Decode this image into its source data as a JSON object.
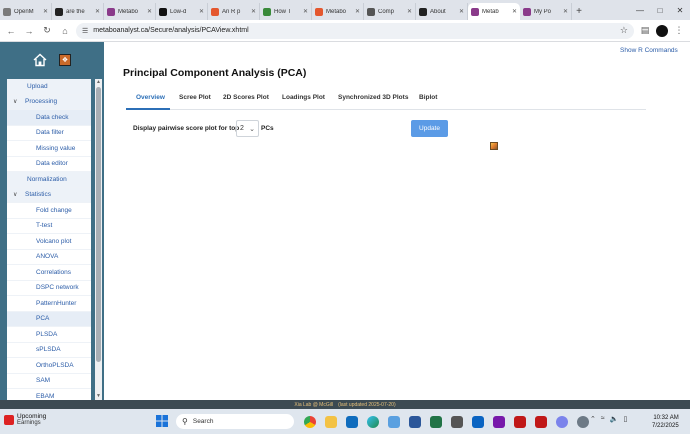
{
  "browser": {
    "tabs": [
      {
        "title": "OpenM",
        "color": "#7a7a7a"
      },
      {
        "title": "are the",
        "color": "#222222"
      },
      {
        "title": "Metabo",
        "color": "#8a3a8a"
      },
      {
        "title": "Low-d",
        "color": "#111111"
      },
      {
        "title": "An R p",
        "color": "#e4572e"
      },
      {
        "title": "How T",
        "color": "#3a8a3a"
      },
      {
        "title": "Metabo",
        "color": "#e4572e"
      },
      {
        "title": "Comp",
        "color": "#555555"
      },
      {
        "title": "About",
        "color": "#222222"
      },
      {
        "title": "Metab",
        "color": "#8a3a8a",
        "active": true
      },
      {
        "title": "My Po",
        "color": "#8a3a8a"
      }
    ],
    "url": "metaboanalyst.ca/Secure/analysis/PCAView.xhtml"
  },
  "sidebar": {
    "items": [
      {
        "label": "Upload",
        "level": 1
      },
      {
        "label": "Processing",
        "level": 1,
        "expanded": true
      },
      {
        "label": "Data check",
        "level": 2,
        "selected": true
      },
      {
        "label": "Data filter",
        "level": 2
      },
      {
        "label": "Missing value",
        "level": 2
      },
      {
        "label": "Data editor",
        "level": 2
      },
      {
        "label": "Normalization",
        "level": 1
      },
      {
        "label": "Statistics",
        "level": 1,
        "expanded": true
      },
      {
        "label": "Fold change",
        "level": 2
      },
      {
        "label": "T-test",
        "level": 2
      },
      {
        "label": "Volcano plot",
        "level": 2
      },
      {
        "label": "ANOVA",
        "level": 2
      },
      {
        "label": "Correlations",
        "level": 2
      },
      {
        "label": "DSPC network",
        "level": 2
      },
      {
        "label": "PatternHunter",
        "level": 2
      },
      {
        "label": "PCA",
        "level": 2,
        "selected": true
      },
      {
        "label": "PLSDA",
        "level": 2
      },
      {
        "label": "sPLSDA",
        "level": 2
      },
      {
        "label": "OrthoPLSDA",
        "level": 2
      },
      {
        "label": "SAM",
        "level": 2
      },
      {
        "label": "EBAM",
        "level": 2
      }
    ]
  },
  "main": {
    "show_r": "Show R Commands",
    "title": "Principal Component Analysis (PCA)",
    "tabs": [
      {
        "label": "Overview",
        "active": true
      },
      {
        "label": "Scree Plot"
      },
      {
        "label": "2D Scores Plot"
      },
      {
        "label": "Loadings Plot"
      },
      {
        "label": "Synchronized 3D Plots"
      },
      {
        "label": "Biplot"
      }
    ],
    "option_label": "Display pairwise score plot for top",
    "select_value": "2",
    "pcs_label": "PCs",
    "update_label": "Update"
  },
  "footer": {
    "lab": "Xia Lab @ McGill",
    "updated": "(last updated 2025-07-20)"
  },
  "taskbar": {
    "weather_title": "Upcoming",
    "weather_sub": "Earnings",
    "search_placeholder": "Search",
    "time": "10:32 AM",
    "date": "7/22/2025"
  }
}
